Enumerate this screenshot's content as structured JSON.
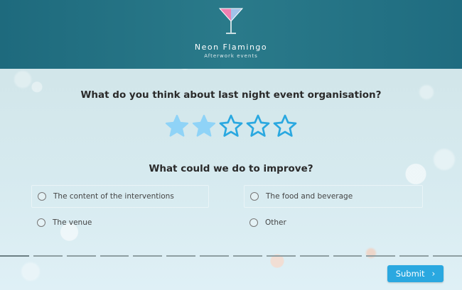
{
  "brand": {
    "name": "Neon Flamingo",
    "tagline": "Afterwork events"
  },
  "question1": {
    "text": "What do you think about last night event organisation?",
    "rating": 2,
    "max": 5
  },
  "question2": {
    "text": "What could we do to improve?",
    "options": [
      "The content of the interventions",
      "The food and beverage",
      "The venue",
      "Other"
    ]
  },
  "progress": {
    "steps": 14,
    "current": 1
  },
  "submit": {
    "label": "Submit"
  },
  "colors": {
    "header": "#1f6c80",
    "star_filled": "#8fd3f7",
    "star_outline": "#2aa8e0",
    "button": "#2aa8e0"
  }
}
